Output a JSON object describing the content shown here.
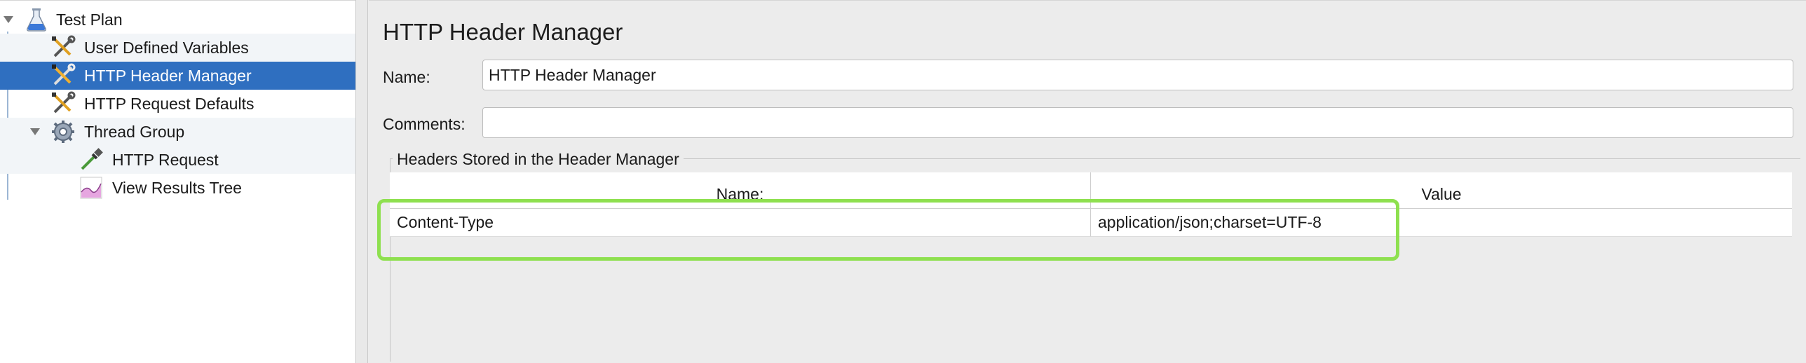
{
  "tree": {
    "items": [
      {
        "label": "Test Plan",
        "icon": "flask-icon",
        "expanded": true
      },
      {
        "label": "User Defined Variables",
        "icon": "wrench-screwdriver-icon"
      },
      {
        "label": "HTTP Header Manager",
        "icon": "wrench-screwdriver-icon",
        "selected": true
      },
      {
        "label": "HTTP Request Defaults",
        "icon": "wrench-screwdriver-icon"
      },
      {
        "label": "Thread Group",
        "icon": "gear-icon",
        "expanded": true
      },
      {
        "label": "HTTP Request",
        "icon": "pipette-icon"
      },
      {
        "label": "View Results Tree",
        "icon": "chart-icon"
      }
    ]
  },
  "editor": {
    "title": "HTTP Header Manager",
    "name_label": "Name:",
    "name_value": "HTTP Header Manager",
    "comments_label": "Comments:",
    "comments_value": "",
    "group_title": "Headers Stored in the Header Manager",
    "table": {
      "columns": [
        "Name:",
        "Value"
      ],
      "rows": [
        {
          "name": "Content-Type",
          "value": "application/json;charset=UTF-8"
        }
      ]
    }
  },
  "colors": {
    "selection": "#2f6fc0",
    "highlight": "#8ee04f"
  }
}
